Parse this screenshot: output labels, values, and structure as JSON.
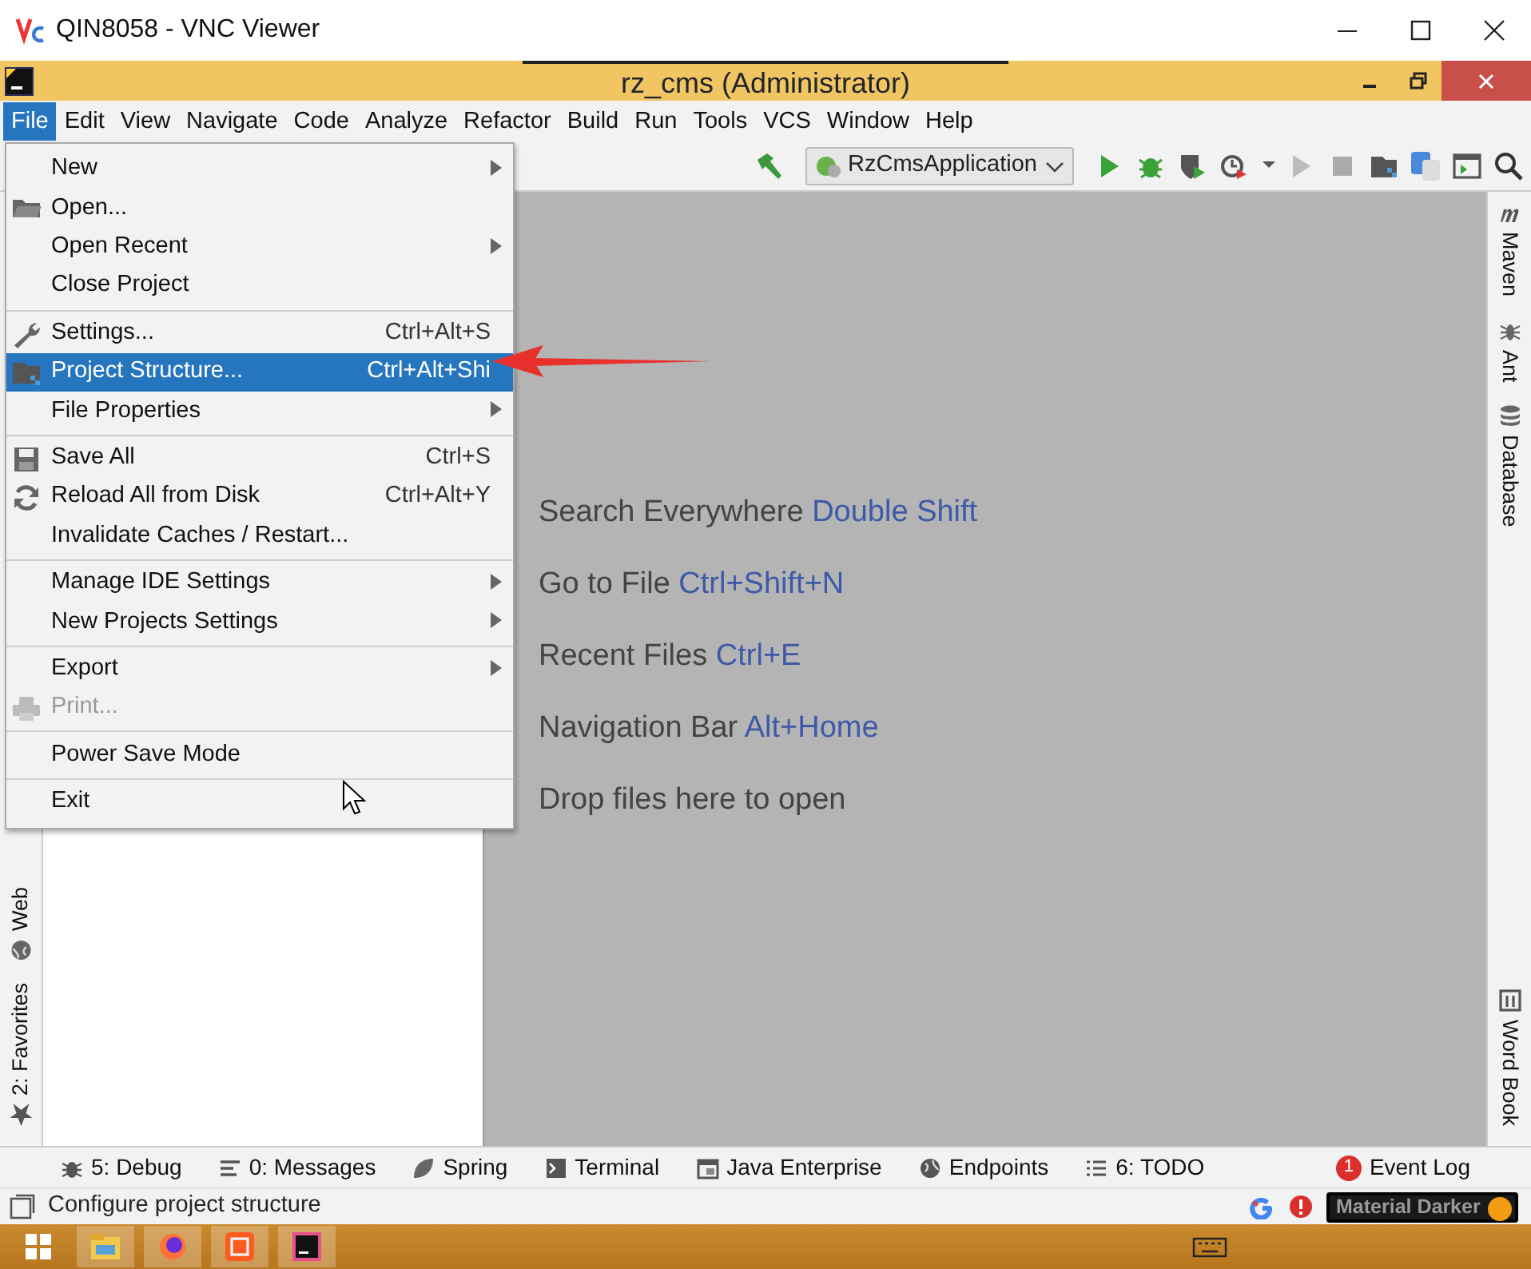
{
  "vnc_window": {
    "title": "QIN8058 - VNC Viewer"
  },
  "ide_window": {
    "title": "rz_cms (Administrator)"
  },
  "menu_bar": [
    {
      "label": "File",
      "selected": true
    },
    {
      "label": "Edit",
      "selected": false
    },
    {
      "label": "View",
      "selected": false
    },
    {
      "label": "Navigate",
      "selected": false
    },
    {
      "label": "Code",
      "selected": false
    },
    {
      "label": "Analyze",
      "selected": false
    },
    {
      "label": "Refactor",
      "selected": false
    },
    {
      "label": "Build",
      "selected": false
    },
    {
      "label": "Run",
      "selected": false
    },
    {
      "label": "Tools",
      "selected": false
    },
    {
      "label": "VCS",
      "selected": false
    },
    {
      "label": "Window",
      "selected": false
    },
    {
      "label": "Help",
      "selected": false
    }
  ],
  "file_menu": [
    [
      {
        "label": "New",
        "submenu": true,
        "disabled": false,
        "selected": false
      },
      {
        "label": "Open...",
        "submenu": false,
        "disabled": false,
        "selected": false
      },
      {
        "label": "Open Recent",
        "submenu": true,
        "disabled": false,
        "selected": false
      },
      {
        "label": "Close Project",
        "submenu": false,
        "disabled": false,
        "selected": false
      }
    ],
    [
      {
        "label": "Settings...",
        "shortcut": "Ctrl+Alt+S",
        "submenu": false,
        "disabled": false,
        "selected": false
      },
      {
        "label": "Project Structure...",
        "shortcut": "Ctrl+Alt+Shi",
        "submenu": false,
        "disabled": false,
        "selected": true
      },
      {
        "label": "File Properties",
        "submenu": true,
        "disabled": false,
        "selected": false
      }
    ],
    [
      {
        "label": "Save All",
        "shortcut": "Ctrl+S",
        "submenu": false,
        "disabled": false,
        "selected": false
      },
      {
        "label": "Reload All from Disk",
        "shortcut": "Ctrl+Alt+Y",
        "submenu": false,
        "disabled": false,
        "selected": false
      },
      {
        "label": "Invalidate Caches / Restart...",
        "submenu": false,
        "disabled": false,
        "selected": false
      }
    ],
    [
      {
        "label": "Manage IDE Settings",
        "submenu": true,
        "disabled": false,
        "selected": false
      },
      {
        "label": "New Projects Settings",
        "submenu": true,
        "disabled": false,
        "selected": false
      }
    ],
    [
      {
        "label": "Export",
        "submenu": true,
        "disabled": false,
        "selected": false
      },
      {
        "label": "Print...",
        "submenu": false,
        "disabled": true,
        "selected": false
      }
    ],
    [
      {
        "label": "Power Save Mode",
        "submenu": false,
        "disabled": false,
        "selected": false
      }
    ],
    [
      {
        "label": "Exit",
        "submenu": false,
        "disabled": false,
        "selected": false
      }
    ]
  ],
  "toolbar": {
    "run_configuration": "RzCmsApplication"
  },
  "editor_hints": [
    {
      "text": "Search Everywhere",
      "shortcut": "Double Shift"
    },
    {
      "text": "Go to File",
      "shortcut": "Ctrl+Shift+N"
    },
    {
      "text": "Recent Files",
      "shortcut": "Ctrl+E"
    },
    {
      "text": "Navigation Bar",
      "shortcut": "Alt+Home"
    },
    {
      "text": "Drop files here to open"
    }
  ],
  "left_stripe": [
    {
      "label": "Web"
    },
    {
      "label": "2: Favorites"
    }
  ],
  "right_stripe": [
    {
      "label": "Maven"
    },
    {
      "label": "Ant"
    },
    {
      "label": "Database"
    },
    {
      "label": "Word Book"
    }
  ],
  "tool_tabs": [
    {
      "label": "5: Debug"
    },
    {
      "label": "0: Messages"
    },
    {
      "label": "Spring"
    },
    {
      "label": "Terminal"
    },
    {
      "label": "Java Enterprise"
    },
    {
      "label": "Endpoints"
    },
    {
      "label": "6: TODO"
    }
  ],
  "event_log": {
    "count": "1",
    "label": "Event Log"
  },
  "status_bar": {
    "message": "Configure project structure",
    "theme": "Material Darker"
  }
}
